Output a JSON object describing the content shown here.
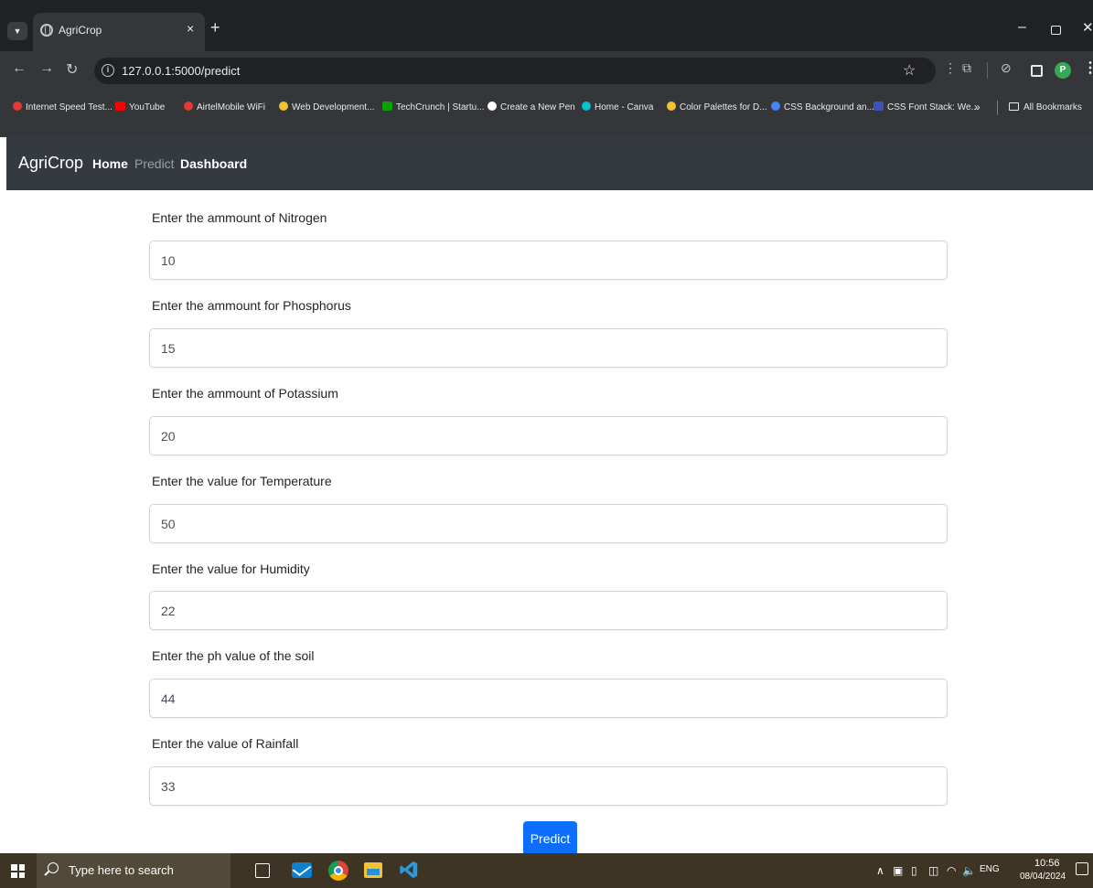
{
  "browser": {
    "tab_title": "AgriCrop",
    "tab_close_glyph": "×",
    "new_tab_glyph": "+",
    "url": "127.0.0.1:5000/predict",
    "bookmarks": [
      {
        "label": "Internet Speed Test...",
        "favicon_color": "#e53935"
      },
      {
        "label": "YouTube",
        "favicon_color": "#ff0000"
      },
      {
        "label": "AirtelMobile WiFi",
        "favicon_color": "#e53935"
      },
      {
        "label": "Web Development...",
        "favicon_color": "#f4c232"
      },
      {
        "label": "TechCrunch | Startu...",
        "favicon_color": "#0a9e01"
      },
      {
        "label": "Create a New Pen",
        "favicon_color": "#ffffff"
      },
      {
        "label": "Home - Canva",
        "favicon_color": "#00c4cc"
      },
      {
        "label": "Color Palettes for D...",
        "favicon_color": "#f4c232"
      },
      {
        "label": "CSS Background an...",
        "favicon_color": "#4285f4"
      },
      {
        "label": "CSS Font Stack: We...",
        "favicon_color": "#3f51b5"
      }
    ],
    "bookmarks_overflow": "»",
    "all_bookmarks": "All Bookmarks",
    "profile_initial": "P"
  },
  "app": {
    "brand": "AgriCrop",
    "nav": {
      "home": "Home",
      "predict": "Predict",
      "dashboard": "Dashboard"
    },
    "form": {
      "fields": [
        {
          "label": "Enter the ammount of Nitrogen",
          "value": "10"
        },
        {
          "label": "Enter the ammount for Phosphorus",
          "value": "15"
        },
        {
          "label": "Enter the ammount of Potassium",
          "value": "20"
        },
        {
          "label": "Enter the value for Temperature",
          "value": "50"
        },
        {
          "label": "Enter the value for Humidity",
          "value": "22"
        },
        {
          "label": "Enter the ph value of the soil",
          "value": "44"
        },
        {
          "label": "Enter the value of Rainfall",
          "value": "33"
        }
      ],
      "submit_label": "Predict"
    }
  },
  "taskbar": {
    "search_placeholder": "Type here to search",
    "language": "ENG",
    "time": "10:56",
    "date": "08/04/2024"
  },
  "colors": {
    "navbar_bg": "#343a40",
    "primary_button": "#0d6efd",
    "taskbar_bg": "#3d3424"
  }
}
